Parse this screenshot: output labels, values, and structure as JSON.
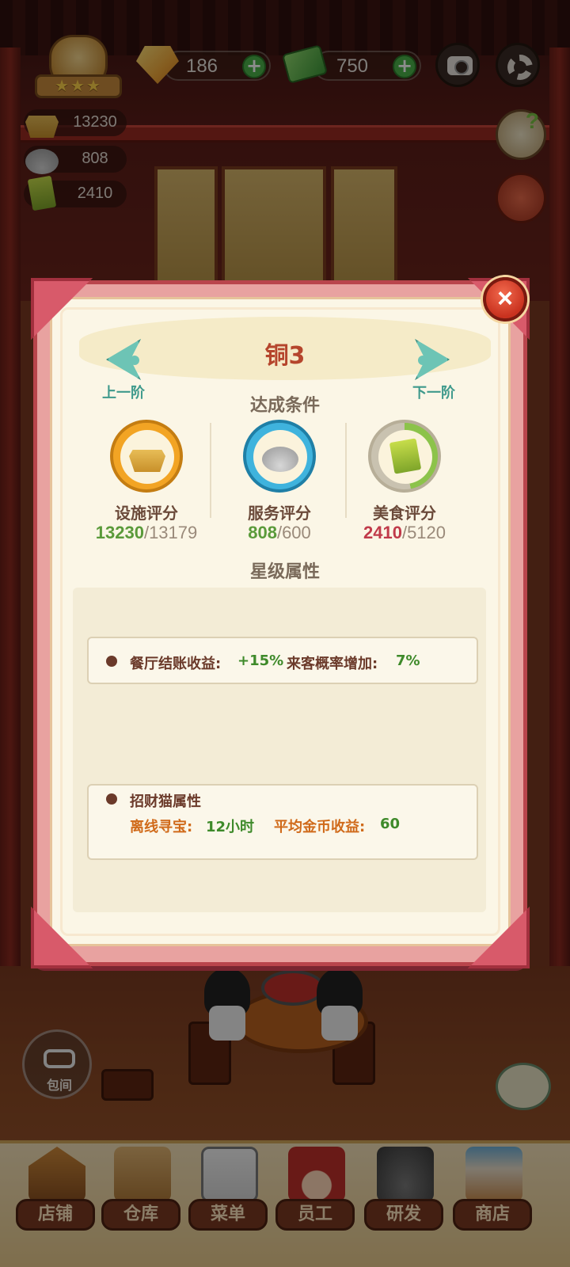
{
  "hud": {
    "gems": "186",
    "cash": "750",
    "stats": {
      "facility": "13230",
      "service": "808",
      "food": "2410"
    }
  },
  "dialog": {
    "rank_title": "铜3",
    "prev_label": "上一阶",
    "next_label": "下一阶",
    "conditions_title": "达成条件",
    "conditions": [
      {
        "name": "设施评分",
        "current": "13230",
        "sep": "/",
        "required": "13179",
        "met": true,
        "ring_color": "#f2a424",
        "icon": "gold-ingot-icon"
      },
      {
        "name": "服务评分",
        "current": "808",
        "sep": "/",
        "required": "600",
        "met": true,
        "ring_color": "#3fb3dd",
        "icon": "cloche-icon"
      },
      {
        "name": "美食评分",
        "current": "2410",
        "sep": "/",
        "required": "5120",
        "met": false,
        "ring_color": "#8cc34a",
        "icon": "recipe-book-icon"
      }
    ],
    "star_attr_title": "星级属性",
    "restaurant_attrs": {
      "checkout_label": "餐厅结账收益:",
      "checkout_value": "+15%",
      "guest_label": "来客概率增加:",
      "guest_value": "7%"
    },
    "lucky_cat": {
      "title": "招财猫属性",
      "offline_label": "离线寻宝:",
      "offline_value": "12小时",
      "avg_label": "平均金币收益:",
      "avg_value": "60"
    },
    "close_symbol": "×"
  },
  "room_button": "包间",
  "bottom_nav": [
    {
      "label": "店铺",
      "icon": "shop-building-icon"
    },
    {
      "label": "仓库",
      "icon": "warehouse-box-icon"
    },
    {
      "label": "菜单",
      "icon": "menu-clipboard-icon"
    },
    {
      "label": "员工",
      "icon": "staff-chef-icon"
    },
    {
      "label": "研发",
      "icon": "wok-research-icon"
    },
    {
      "label": "商店",
      "icon": "store-front-icon"
    }
  ],
  "colors": {
    "met": "#5a9a3a",
    "unmet": "#c03a4a",
    "accent_teal": "#3f9a8c",
    "title_red": "#b5452c"
  }
}
